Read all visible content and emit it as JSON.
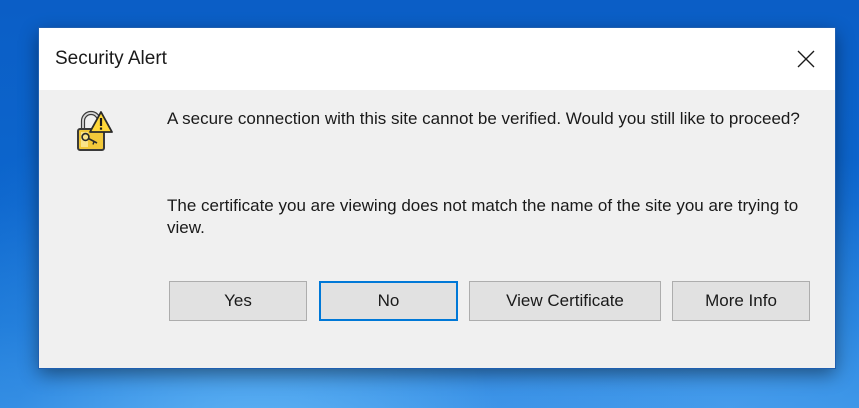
{
  "dialog": {
    "title": "Security Alert",
    "icon": "padlock-warning-icon",
    "message_primary": "A secure connection with this site cannot be verified. Would you still like to proceed?",
    "message_secondary": "The certificate you are viewing does not match the name of the site you are trying to view.",
    "buttons": {
      "yes": "Yes",
      "no": "No",
      "view_certificate": "View Certificate",
      "more_info": "More Info"
    },
    "default_button": "no"
  },
  "colors": {
    "desktop": "#0a5fc4",
    "dialog_body": "#f0f0f0",
    "titlebar": "#ffffff",
    "button_face": "#e1e1e1",
    "focus_border": "#0078d7",
    "warning_yellow": "#ffd83a"
  }
}
